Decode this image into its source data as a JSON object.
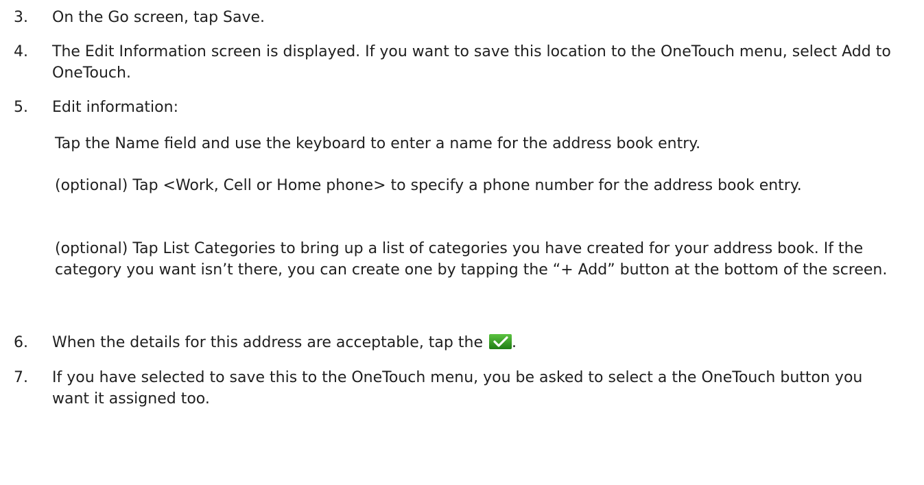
{
  "steps": [
    {
      "num": "3.",
      "text": "On the Go screen, tap Save."
    },
    {
      "num": "4.",
      "text": "The Edit Information screen is displayed.  If you want to save this location to the OneTouch menu, select Add to OneTouch."
    },
    {
      "num": "5.",
      "text": "Edit information:"
    },
    {
      "num": "6.",
      "text_before": "When the details for this address are acceptable, tap the ",
      "text_after": "."
    },
    {
      "num": "7.",
      "text": "If you have selected to save this to the OneTouch menu, you be asked to select a the OneTouch button you want it assigned too."
    }
  ],
  "substeps": [
    "Tap the Name field and use the keyboard to enter a name for the address book entry.",
    "(optional) Tap <Work, Cell or Home phone> to specify a phone number for the address book entry.",
    "(optional) Tap List Categories to bring up a list of categories you have created for your address book.  If the category you want isn’t there, you can create one by tapping the “+ Add” button at the bottom of the screen."
  ],
  "icons": {
    "checkmark": "green-checkmark-icon",
    "check_bg": "#2e9a1f",
    "check_mark": "#ffffff"
  }
}
